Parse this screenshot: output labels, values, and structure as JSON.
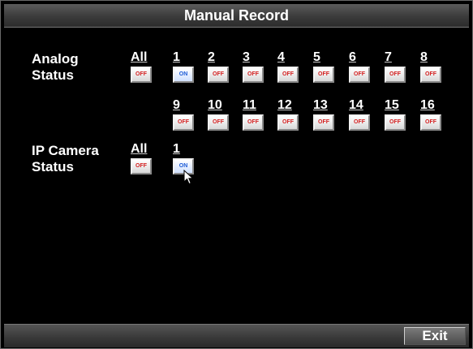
{
  "window": {
    "title": "Manual Record"
  },
  "analog": {
    "label_line1": "Analog",
    "label_line2": "Status",
    "all_label": "All",
    "all_state": "OFF",
    "channels": [
      {
        "num": "1",
        "state": "ON"
      },
      {
        "num": "2",
        "state": "OFF"
      },
      {
        "num": "3",
        "state": "OFF"
      },
      {
        "num": "4",
        "state": "OFF"
      },
      {
        "num": "5",
        "state": "OFF"
      },
      {
        "num": "6",
        "state": "OFF"
      },
      {
        "num": "7",
        "state": "OFF"
      },
      {
        "num": "8",
        "state": "OFF"
      },
      {
        "num": "9",
        "state": "OFF"
      },
      {
        "num": "10",
        "state": "OFF"
      },
      {
        "num": "11",
        "state": "OFF"
      },
      {
        "num": "12",
        "state": "OFF"
      },
      {
        "num": "13",
        "state": "OFF"
      },
      {
        "num": "14",
        "state": "OFF"
      },
      {
        "num": "15",
        "state": "OFF"
      },
      {
        "num": "16",
        "state": "OFF"
      }
    ]
  },
  "ip_camera": {
    "label_line1": "IP Camera",
    "label_line2": "Status",
    "all_label": "All",
    "all_state": "OFF",
    "channels": [
      {
        "num": "1",
        "state": "ON"
      }
    ]
  },
  "footer": {
    "exit_label": "Exit"
  },
  "icons": {
    "cursor": "mouse-pointer-icon"
  },
  "colors": {
    "off_text": "#d42020",
    "on_text": "#1c5ad6",
    "background": "#000000"
  }
}
